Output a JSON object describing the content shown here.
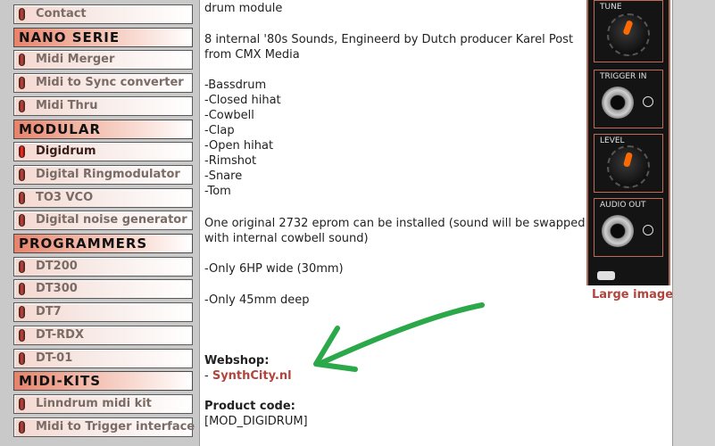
{
  "sidebar": {
    "items": [
      {
        "type": "item",
        "label": "Contact"
      },
      {
        "type": "header",
        "label": "NANO SERIE"
      },
      {
        "type": "item",
        "label": "Midi Merger"
      },
      {
        "type": "item",
        "label": "Midi to Sync converter"
      },
      {
        "type": "item",
        "label": "Midi Thru"
      },
      {
        "type": "header",
        "label": "MODULAR"
      },
      {
        "type": "item",
        "label": "Digidrum",
        "active": true
      },
      {
        "type": "item",
        "label": "Digital Ringmodulator"
      },
      {
        "type": "item",
        "label": "TO3 VCO"
      },
      {
        "type": "item",
        "label": "Digital noise generator"
      },
      {
        "type": "header",
        "label": "PROGRAMMERS"
      },
      {
        "type": "item",
        "label": "DT200"
      },
      {
        "type": "item",
        "label": "DT300"
      },
      {
        "type": "item",
        "label": "DT7"
      },
      {
        "type": "item",
        "label": "DT-RDX"
      },
      {
        "type": "item",
        "label": "DT-01"
      },
      {
        "type": "header",
        "label": "MIDI-KITS"
      },
      {
        "type": "item",
        "label": "Linndrum midi kit"
      },
      {
        "type": "item",
        "label": "Midi to Trigger interface"
      }
    ]
  },
  "content": {
    "intro_tail": "drum module",
    "sounds_line1": "8 internal '80s Sounds, Engineerd by Dutch producer Karel Post",
    "sounds_line2": "from CMX Media",
    "sound_list": [
      "-Bassdrum",
      "-Closed hihat",
      "-Cowbell",
      "-Clap",
      "-Open hihat",
      "-Rimshot",
      "-Snare",
      "-Tom"
    ],
    "eprom_line1": "One original 2732 eprom can be installed (sound will be swapped",
    "eprom_line2": "with internal cowbell sound)",
    "width_note": "-Only 6HP wide (30mm)",
    "depth_note": "-Only 45mm deep",
    "webshop_label": "Webshop:",
    "webshop_dash": "- ",
    "webshop_link": "SynthCity.nl",
    "product_code_label": "Product code:",
    "product_code": "[MOD_DIGIDRUM]"
  },
  "module_image": {
    "tune_label": "TUNE",
    "trigger_label": "TRIGGER IN",
    "level_label": "LEVEL",
    "audio_label": "AUDIO OUT",
    "large_image_link": "Large image"
  },
  "colors": {
    "link": "#b0453d",
    "arrow": "#2aa84a",
    "knob_pointer": "#ff6a00"
  }
}
